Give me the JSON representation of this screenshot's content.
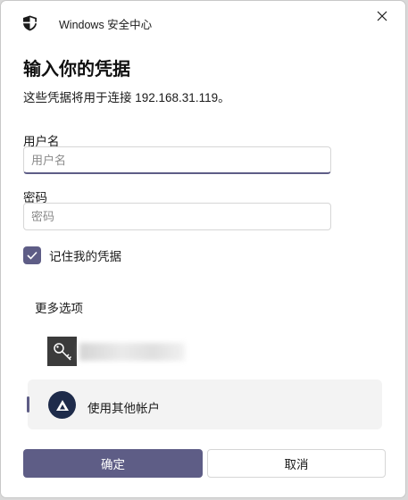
{
  "window": {
    "app_title": "Windows 安全中心"
  },
  "dialog": {
    "heading": "输入你的凭据",
    "subtitle": "这些凭据将用于连接 192.168.31.119。"
  },
  "username": {
    "label": "用户名",
    "placeholder": "用户名",
    "value": ""
  },
  "password": {
    "label": "密码",
    "placeholder": "密码",
    "value": ""
  },
  "remember": {
    "label": "记住我的凭据",
    "checked": true
  },
  "more_options": {
    "label": "更多选项"
  },
  "other_account": {
    "label": "使用其他帐户"
  },
  "buttons": {
    "ok": "确定",
    "cancel": "取消"
  },
  "colors": {
    "accent": "#5e5d86",
    "avatar_bg": "#1e2b4a",
    "key_tile": "#3b3b3b"
  }
}
